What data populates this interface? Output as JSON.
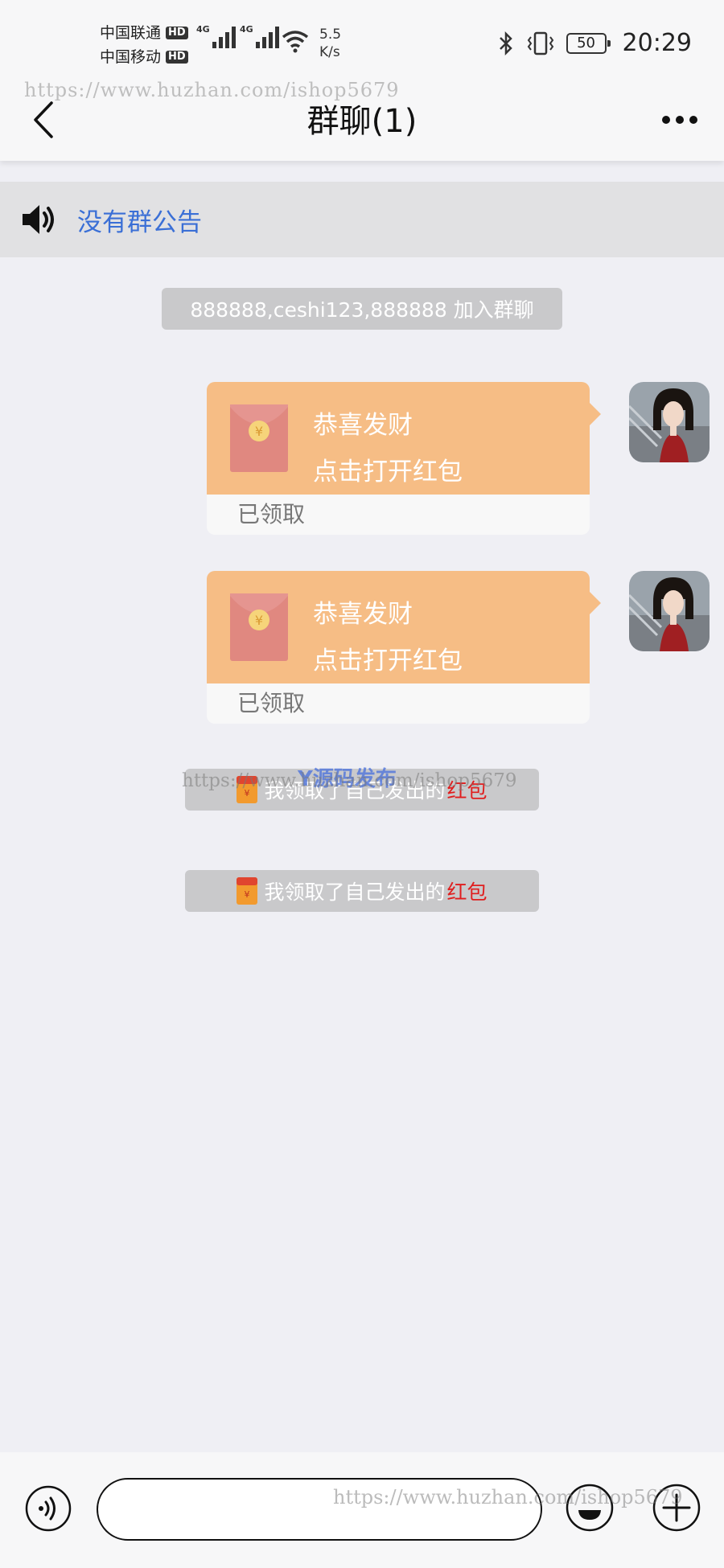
{
  "status_bar": {
    "carrier1": "中国联通",
    "carrier2": "中国移动",
    "hd_badge": "HD",
    "network_tag": "4G",
    "speed_value": "5.5",
    "speed_unit": "K/s",
    "battery": "50",
    "time": "20:29"
  },
  "header": {
    "title": "群聊(1)",
    "back_icon": "chevron-left-icon",
    "more_icon": "more-dots-icon"
  },
  "watermark": {
    "url": "https://www.huzhan.com/ishop5679",
    "logo": "Y源码发布"
  },
  "notice": {
    "icon": "speaker-icon",
    "text": "没有群公告"
  },
  "system_messages": {
    "join": "888888,ceshi123,888888 加入群聊",
    "claim_prefix": "我领取了自己发出的",
    "claim_highlight": "红包"
  },
  "messages": [
    {
      "type": "red_packet",
      "title": "恭喜发财",
      "subtitle": "点击打开红包",
      "status": "已领取"
    },
    {
      "type": "red_packet",
      "title": "恭喜发财",
      "subtitle": "点击打开红包",
      "status": "已领取"
    }
  ],
  "input_bar": {
    "voice_icon": "voice-icon",
    "input_value": "",
    "emoji_icon": "emoji-icon",
    "plus_icon": "plus-icon"
  },
  "colors": {
    "red_packet": "#f6bd85",
    "notice_link": "#3a6fd6",
    "highlight_red": "#e01e1e",
    "background": "#efeff4"
  }
}
